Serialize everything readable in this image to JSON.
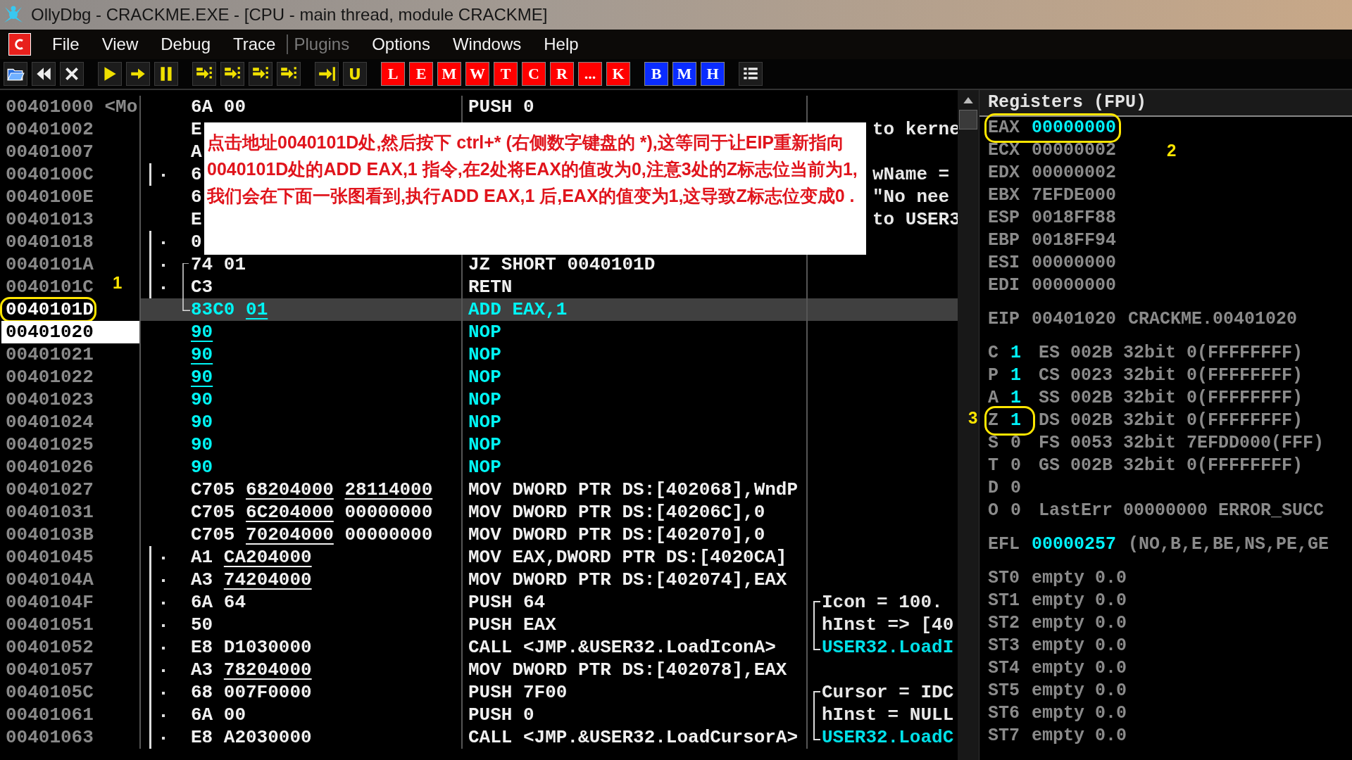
{
  "window": {
    "title": "OllyDbg - CRACKME.EXE - [CPU - main thread, module CRACKME]"
  },
  "menu": [
    {
      "label": "File",
      "disabled": false
    },
    {
      "label": "View",
      "disabled": false
    },
    {
      "label": "Debug",
      "disabled": false
    },
    {
      "label": "Trace",
      "disabled": false
    },
    {
      "label": "Plugins",
      "disabled": true
    },
    {
      "label": "Options",
      "disabled": false
    },
    {
      "label": "Windows",
      "disabled": false
    },
    {
      "label": "Help",
      "disabled": false
    }
  ],
  "toolbar": [
    {
      "kind": "icon"
    },
    {
      "kind": "icon"
    },
    {
      "kind": "icon"
    },
    {
      "kind": "sep"
    },
    {
      "kind": "icon"
    },
    {
      "kind": "icon"
    },
    {
      "kind": "icon"
    },
    {
      "kind": "sep"
    },
    {
      "kind": "icon"
    },
    {
      "kind": "icon"
    },
    {
      "kind": "icon"
    },
    {
      "kind": "icon"
    },
    {
      "kind": "sep"
    },
    {
      "kind": "icon"
    },
    {
      "kind": "glyph",
      "label": "U"
    },
    {
      "kind": "sep"
    },
    {
      "kind": "letter",
      "label": "L",
      "color": "#ff0000"
    },
    {
      "kind": "letter",
      "label": "E",
      "color": "#ff0000"
    },
    {
      "kind": "letter",
      "label": "M",
      "color": "#ff0000"
    },
    {
      "kind": "letter",
      "label": "W",
      "color": "#ff0000"
    },
    {
      "kind": "letter",
      "label": "T",
      "color": "#ff0000"
    },
    {
      "kind": "letter",
      "label": "C",
      "color": "#ff0000"
    },
    {
      "kind": "letter",
      "label": "R",
      "color": "#ff0000"
    },
    {
      "kind": "letter",
      "label": "...",
      "color": "#ff0000"
    },
    {
      "kind": "letter",
      "label": "K",
      "color": "#ff0000"
    },
    {
      "kind": "sep"
    },
    {
      "kind": "letter",
      "label": "B",
      "color": "#0a2cff"
    },
    {
      "kind": "letter",
      "label": "M",
      "color": "#0a2cff"
    },
    {
      "kind": "letter",
      "label": "H",
      "color": "#0a2cff"
    },
    {
      "kind": "sep"
    },
    {
      "kind": "icon"
    }
  ],
  "disassembly": {
    "rows": [
      {
        "address": "00401000 <Mo",
        "hex": [
          {
            "text": "6A 00",
            "underline": false
          }
        ],
        "disasm": "PUSH 0"
      },
      {
        "address": "00401002",
        "hex": [
          {
            "text": "E",
            "underline": false
          }
        ],
        "comment": {
          "text": "to kerne"
        }
      },
      {
        "address": "00401007",
        "hex": [
          {
            "text": "A",
            "underline": false
          }
        ]
      },
      {
        "address": "0040100C",
        "hex": [
          {
            "text": "6",
            "underline": false
          }
        ],
        "bracket": true,
        "dot": true,
        "comment": {
          "text": "wName ="
        }
      },
      {
        "address": "0040100E",
        "hex": [
          {
            "text": "6",
            "underline": false
          }
        ],
        "comment": {
          "text": "\"No nee"
        }
      },
      {
        "address": "00401013",
        "hex": [
          {
            "text": "E",
            "underline": false
          }
        ],
        "comment": {
          "text": "to USER3"
        }
      },
      {
        "address": "00401018",
        "hex": [
          {
            "text": "0",
            "underline": false
          }
        ],
        "bracket": true,
        "dot": true
      },
      {
        "address": "0040101A",
        "hex": [
          {
            "text": "74 01",
            "underline": false
          }
        ],
        "disasm": "JZ SHORT 0040101D",
        "bracket": true,
        "dot": true,
        "jump_start": true
      },
      {
        "address": "0040101C",
        "hex": [
          {
            "text": "C3",
            "underline": false
          }
        ],
        "disasm": "RETN",
        "bracket": true,
        "dot": true,
        "callout": "1"
      },
      {
        "address": "0040101D",
        "hex": [
          {
            "text": "83C0",
            "underline": false
          },
          {
            "text": "01",
            "underline": true
          }
        ],
        "disasm": "ADD EAX,1",
        "modified": true,
        "selected": true,
        "circled": true,
        "jump_target": true
      },
      {
        "address": "00401020",
        "hex": [
          {
            "text": "90",
            "underline": true
          }
        ],
        "disasm": "NOP",
        "modified": true,
        "eip": true
      },
      {
        "address": "00401021",
        "hex": [
          {
            "text": "90",
            "underline": true
          }
        ],
        "disasm": "NOP",
        "modified": true
      },
      {
        "address": "00401022",
        "hex": [
          {
            "text": "90",
            "underline": true
          }
        ],
        "disasm": "NOP",
        "modified": true
      },
      {
        "address": "00401023",
        "hex": [
          {
            "text": "90",
            "underline": false
          }
        ],
        "disasm": "NOP",
        "modified": true
      },
      {
        "address": "00401024",
        "hex": [
          {
            "text": "90",
            "underline": false
          }
        ],
        "disasm": "NOP",
        "modified": true
      },
      {
        "address": "00401025",
        "hex": [
          {
            "text": "90",
            "underline": false
          }
        ],
        "disasm": "NOP",
        "modified": true
      },
      {
        "address": "00401026",
        "hex": [
          {
            "text": "90",
            "underline": false
          }
        ],
        "disasm": "NOP",
        "modified": true
      },
      {
        "address": "00401027",
        "hex": [
          {
            "text": "C705",
            "underline": false
          },
          {
            "text": "68204000",
            "underline": true
          },
          {
            "text": "28114000",
            "underline": true
          }
        ],
        "disasm": "MOV DWORD PTR DS:[402068],WndP"
      },
      {
        "address": "00401031",
        "hex": [
          {
            "text": "C705",
            "underline": false
          },
          {
            "text": "6C204000",
            "underline": true
          },
          {
            "text": "00000000",
            "underline": false
          }
        ],
        "disasm": "MOV DWORD PTR DS:[40206C],0"
      },
      {
        "address": "0040103B",
        "hex": [
          {
            "text": "C705",
            "underline": false
          },
          {
            "text": "70204000",
            "underline": true
          },
          {
            "text": "00000000",
            "underline": false
          }
        ],
        "disasm": "MOV DWORD PTR DS:[402070],0"
      },
      {
        "address": "00401045",
        "hex": [
          {
            "text": "A1",
            "underline": false
          },
          {
            "text": "CA204000",
            "underline": true
          }
        ],
        "disasm": "MOV EAX,DWORD PTR DS:[4020CA]",
        "bracket": true,
        "dot": true
      },
      {
        "address": "0040104A",
        "hex": [
          {
            "text": "A3",
            "underline": false
          },
          {
            "text": "74204000",
            "underline": true
          }
        ],
        "disasm": "MOV DWORD PTR DS:[402074],EAX",
        "bracket": true,
        "dot": true
      },
      {
        "address": "0040104F",
        "hex": [
          {
            "text": "6A 64",
            "underline": false
          }
        ],
        "disasm": "PUSH 64",
        "bracket": true,
        "dot": true,
        "comment": {
          "text": "Icon = 100.",
          "kind": "bracket-top",
          "api": false
        }
      },
      {
        "address": "00401051",
        "hex": [
          {
            "text": "50",
            "underline": false
          }
        ],
        "disasm": "PUSH EAX",
        "bracket": true,
        "dot": true,
        "comment": {
          "text": "hInst => [40",
          "kind": "bracket-mid",
          "api": false
        }
      },
      {
        "address": "00401052",
        "hex": [
          {
            "text": "E8 D1030000",
            "underline": false
          }
        ],
        "disasm": "CALL <JMP.&USER32.LoadIconA>",
        "bracket": true,
        "dot": true,
        "comment": {
          "text": "USER32.LoadI",
          "kind": "bracket-end",
          "api": true
        }
      },
      {
        "address": "00401057",
        "hex": [
          {
            "text": "A3",
            "underline": false
          },
          {
            "text": "78204000",
            "underline": true
          }
        ],
        "disasm": "MOV DWORD PTR DS:[402078],EAX",
        "bracket": true,
        "dot": true
      },
      {
        "address": "0040105C",
        "hex": [
          {
            "text": "68 007F0000",
            "underline": false
          }
        ],
        "disasm": "PUSH 7F00",
        "bracket": true,
        "dot": true,
        "comment": {
          "text": "Cursor = IDC",
          "kind": "bracket-top",
          "api": false
        }
      },
      {
        "address": "00401061",
        "hex": [
          {
            "text": "6A 00",
            "underline": false
          }
        ],
        "disasm": "PUSH 0",
        "bracket": true,
        "dot": true,
        "comment": {
          "text": "hInst = NULL",
          "kind": "bracket-mid",
          "api": false
        }
      },
      {
        "address": "00401063",
        "hex": [
          {
            "text": "E8 A2030000",
            "underline": false
          }
        ],
        "disasm": "CALL <JMP.&USER32.LoadCursorA>",
        "bracket": true,
        "dot": true,
        "comment": {
          "text": "USER32.LoadC",
          "kind": "bracket-end",
          "api": true
        }
      }
    ]
  },
  "note": {
    "text": "点击地址0040101D处,然后按下 ctrl+* (右侧数字键盘的 *),这等同于让EIP重新指向0040101D处的ADD EAX,1 指令,在2处将EAX的值改为0,注意3处的Z标志位当前为1,我们会在下面一张图看到,执行ADD EAX,1 后,EAX的值变为1,这导致Z标志位变成0 ."
  },
  "registers": {
    "title": "Registers (FPU)",
    "general": [
      {
        "name": "EAX",
        "value": "00000000",
        "changed": true,
        "circled": true
      },
      {
        "name": "ECX",
        "value": "00000002",
        "changed": false,
        "callout": "2"
      },
      {
        "name": "EDX",
        "value": "00000002",
        "changed": false
      },
      {
        "name": "EBX",
        "value": "7EFDE000",
        "changed": false
      },
      {
        "name": "ESP",
        "value": "0018FF88",
        "changed": false
      },
      {
        "name": "EBP",
        "value": "0018FF94",
        "changed": false
      },
      {
        "name": "ESI",
        "value": "00000000",
        "changed": false
      },
      {
        "name": "EDI",
        "value": "00000000",
        "changed": false
      }
    ],
    "eip": {
      "name": "EIP",
      "value": "00401020",
      "note": "CRACKME.00401020"
    },
    "flags": [
      {
        "name": "C",
        "value": "1",
        "changed": true,
        "segment": "ES 002B 32bit 0(FFFFFFFF)"
      },
      {
        "name": "P",
        "value": "1",
        "changed": true,
        "segment": "CS 0023 32bit 0(FFFFFFFF)"
      },
      {
        "name": "A",
        "value": "1",
        "changed": true,
        "segment": "SS 002B 32bit 0(FFFFFFFF)"
      },
      {
        "name": "Z",
        "value": "1",
        "changed": true,
        "segment": "DS 002B 32bit 0(FFFFFFFF)",
        "circled": true,
        "callout": "3"
      },
      {
        "name": "S",
        "value": "0",
        "changed": false,
        "segment": "FS 0053 32bit 7EFDD000(FFF)"
      },
      {
        "name": "T",
        "value": "0",
        "changed": false,
        "segment": "GS 002B 32bit 0(FFFFFFFF)"
      },
      {
        "name": "D",
        "value": "0",
        "changed": false
      },
      {
        "name": "O",
        "value": "0",
        "changed": false,
        "segment": "LastErr 00000000 ERROR_SUCC"
      }
    ],
    "efl": {
      "name": "EFL",
      "value": "00000257",
      "changed": true,
      "flags": "(NO,B,E,BE,NS,PE,GE"
    },
    "fpu": [
      {
        "name": "ST0",
        "value": "empty 0.0"
      },
      {
        "name": "ST1",
        "value": "empty 0.0"
      },
      {
        "name": "ST2",
        "value": "empty 0.0"
      },
      {
        "name": "ST3",
        "value": "empty 0.0"
      },
      {
        "name": "ST4",
        "value": "empty 0.0"
      },
      {
        "name": "ST5",
        "value": "empty 0.0"
      },
      {
        "name": "ST6",
        "value": "empty 0.0"
      },
      {
        "name": "ST7",
        "value": "empty 0.0"
      }
    ]
  }
}
